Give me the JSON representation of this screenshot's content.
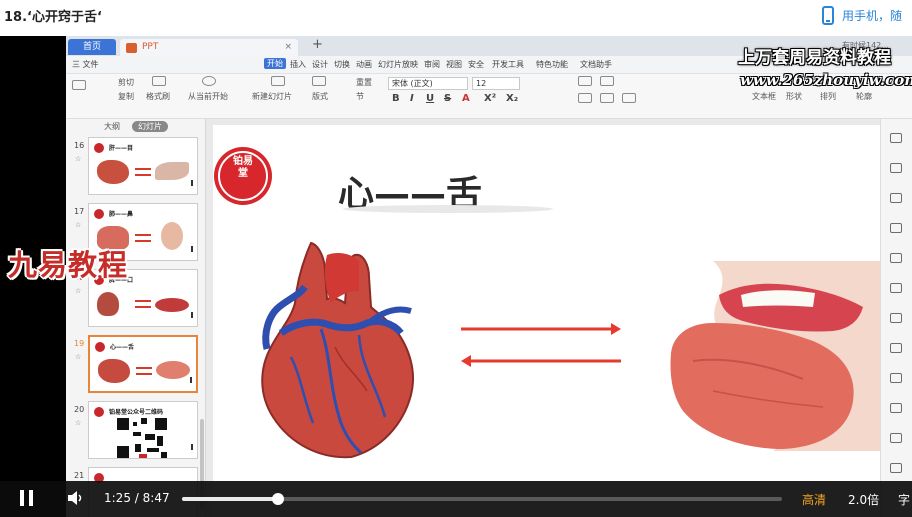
{
  "page": {
    "title": "18.‘心开窍于舌‘",
    "phone_link": "用手机，随"
  },
  "wps": {
    "tab_home": "首页",
    "file_tab": "PPT",
    "user": "有时候142...",
    "menu": [
      "三 文件",
      "开始",
      "插入",
      "设计",
      "切换",
      "动画",
      "幻灯片放映",
      "审阅",
      "视图",
      "安全",
      "开发工具",
      "特色功能",
      "文档助手"
    ],
    "toolbar": {
      "cut": "剪切",
      "copy": "复制",
      "format_painter": "格式刷",
      "play_from_current": "从当前开始",
      "new_slide": "新建幻灯片",
      "layout": "版式",
      "section": "节",
      "reset": "重置",
      "font": "宋体 (正文)",
      "size": "12",
      "format": [
        "B",
        "I",
        "U",
        "S",
        "A",
        "X²",
        "X₂"
      ],
      "textbox": "文本框",
      "shapes": "形状",
      "arrange": "排列",
      "outline": "轮廓"
    },
    "panel": {
      "tabs": [
        "大纲",
        "幻灯片"
      ],
      "slides": [
        {
          "num": "16",
          "title": "肝——目",
          "kind": "liver"
        },
        {
          "num": "17",
          "title": "肺——鼻",
          "kind": "lung"
        },
        {
          "num": "18",
          "title": "脾——口",
          "kind": "spleen"
        },
        {
          "num": "19",
          "title": "心——舌",
          "kind": "heart",
          "selected": true
        },
        {
          "num": "20",
          "title": "铂易堂公众号二维码",
          "kind": "qr"
        },
        {
          "num": "21",
          "title": "",
          "kind": "blank"
        }
      ]
    },
    "slide": {
      "seal_text": "铂易堂",
      "title": "心——舌"
    }
  },
  "watermarks": {
    "top": "上万套周易资料教程",
    "url": "www.265zhouyiw.com",
    "left": "九易教程"
  },
  "player": {
    "current_time": "1:25",
    "duration": "8:47",
    "progress": 0.16,
    "quality": "高清",
    "speed": "2.0倍",
    "subtitle": "字"
  }
}
